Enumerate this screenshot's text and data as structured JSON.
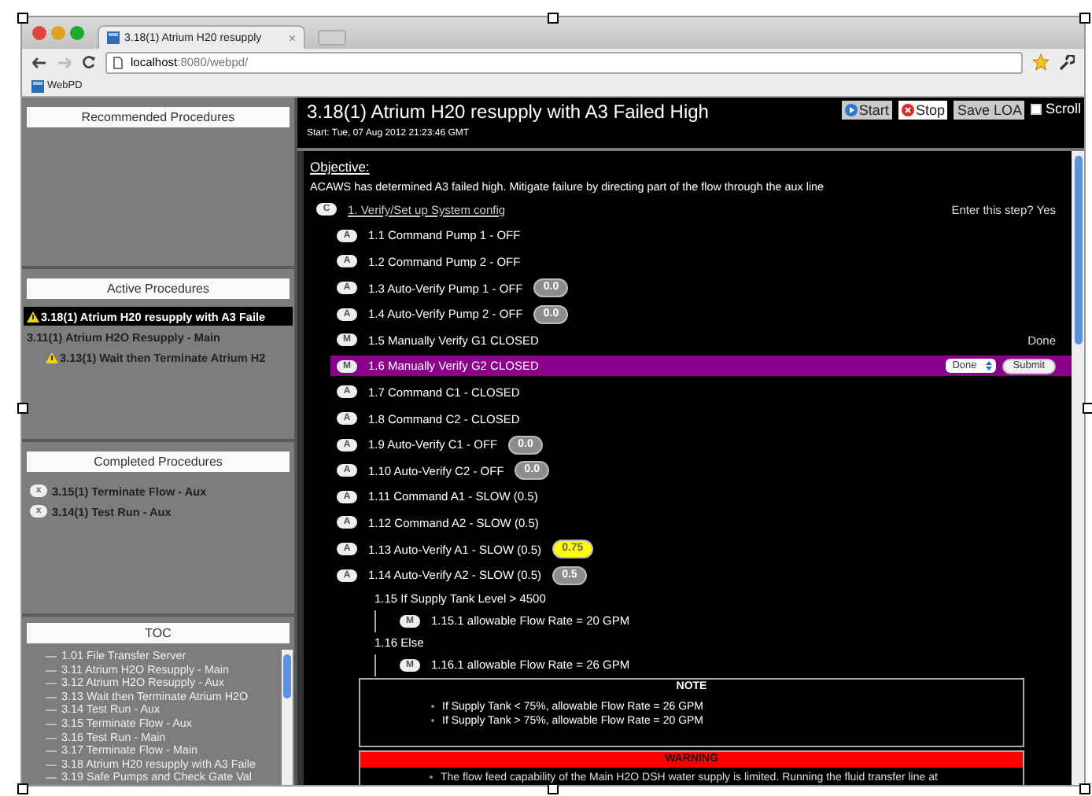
{
  "browser": {
    "tab_title": "3.18(1) Atrium H20 resupply",
    "tab_close": "×",
    "url_host": "localhost",
    "url_path": ":8080/webpd/",
    "bookmark": "WebPD"
  },
  "sidebar": {
    "recommended": {
      "title": "Recommended Procedures"
    },
    "active": {
      "title": "Active Procedures",
      "items": [
        {
          "label": "3.18(1) Atrium H20 resupply with A3 Faile",
          "warning": true,
          "selected": true
        },
        {
          "label": "3.11(1) Atrium H2O Resupply - Main",
          "warning": false,
          "selected": false,
          "children": [
            {
              "label": "3.13(1) Wait then Terminate Atrium H2",
              "warning": true,
              "selected": false
            }
          ]
        }
      ]
    },
    "completed": {
      "title": "Completed Procedures",
      "items": [
        {
          "badge": "x",
          "label": "3.15(1) Terminate Flow - Aux"
        },
        {
          "badge": "x",
          "label": "3.14(1) Test Run - Aux"
        }
      ]
    },
    "toc": {
      "title": "TOC",
      "items": [
        "1.01 File Transfer Server",
        "3.11 Atrium H2O Resupply - Main",
        "3.12 Atrium H2O Resupply - Aux",
        "3.13 Wait then Terminate Atrium H2O",
        "3.14 Test Run - Aux",
        "3.15 Terminate Flow - Aux",
        "3.16 Test Run - Main",
        "3.17 Terminate Flow - Main",
        "3.18 Atrium H20 resupply with A3 Faile",
        "3.19 Safe Pumps and Check Gate Val"
      ]
    }
  },
  "procedure": {
    "title": "3.18(1) Atrium H20 resupply with A3 Failed High",
    "start": "Start: Tue, 07 Aug 2012 21:23:46 GMT",
    "buttons": [
      {
        "kind": "start",
        "label": "Start"
      },
      {
        "kind": "stop",
        "label": "Stop"
      },
      {
        "kind": "plain",
        "label": "Save LOA"
      }
    ],
    "scroll": {
      "label": "Scroll",
      "checked": false
    }
  },
  "objective": {
    "title": "Objective:",
    "text": "ACAWS has determined A3 failed high. Mitigate failure by directing part of the flow through the aux line"
  },
  "steps": [
    {
      "kind": "section",
      "badge": "C",
      "label": "1. Verify/Set up System config",
      "status": "Enter this step? Yes"
    },
    {
      "kind": "step",
      "badge": "A",
      "label": "1.1 Command Pump 1 - OFF",
      "selected": false
    },
    {
      "kind": "step",
      "badge": "A",
      "label": "1.2 Command Pump 2 - OFF",
      "selected": false
    },
    {
      "kind": "step",
      "badge": "A",
      "label": "1.3 Auto-Verify Pump 1 - OFF",
      "selected": false,
      "reading": {
        "text": "0.0",
        "color": "#8c8c8c"
      }
    },
    {
      "kind": "step",
      "badge": "A",
      "label": "1.4 Auto-Verify Pump 2 - OFF",
      "selected": false,
      "reading": {
        "text": "0.0",
        "color": "#8c8c8c"
      }
    },
    {
      "kind": "step",
      "badge": "M",
      "label": "1.5 Manually Verify G1 CLOSED",
      "selected": false,
      "status": "Done"
    },
    {
      "kind": "step",
      "badge": "M",
      "label": "1.6 Manually Verify G2 CLOSED",
      "selected": true,
      "choice": "Done",
      "submit": "Submit"
    },
    {
      "kind": "step",
      "badge": "A",
      "label": "1.7 Command C1 - CLOSED",
      "selected": false
    },
    {
      "kind": "step",
      "badge": "A",
      "label": "1.8 Command C2 - CLOSED",
      "selected": false
    },
    {
      "kind": "step",
      "badge": "A",
      "label": "1.9 Auto-Verify C1 - OFF",
      "selected": false,
      "reading": {
        "text": "0.0",
        "color": "#8c8c8c"
      }
    },
    {
      "kind": "step",
      "badge": "A",
      "label": "1.10 Auto-Verify C2 - OFF",
      "selected": false,
      "reading": {
        "text": "0.0",
        "color": "#8c8c8c"
      }
    },
    {
      "kind": "step",
      "badge": "A",
      "label": "1.11 Command A1 - SLOW (0.5)",
      "selected": false
    },
    {
      "kind": "step",
      "badge": "A",
      "label": "1.12 Command A2 - SLOW (0.5)",
      "selected": false
    },
    {
      "kind": "step",
      "badge": "A",
      "label": "1.13 Auto-Verify A1 - SLOW (0.5)",
      "selected": false,
      "reading": {
        "text": "0.75",
        "color": "#ffff00"
      }
    },
    {
      "kind": "step",
      "badge": "A",
      "label": "1.14 Auto-Verify A2 - SLOW (0.5)",
      "selected": false,
      "reading": {
        "text": "0.5",
        "color": "#8c8c8c"
      }
    },
    {
      "kind": "condition",
      "label": "1.15 If Supply Tank Level > 4500",
      "children": [
        {
          "badge": "M",
          "label": "1.15.1 allowable Flow Rate = 20 GPM"
        }
      ]
    },
    {
      "kind": "condition",
      "label": "1.16 Else",
      "children": [
        {
          "badge": "M",
          "label": "1.16.1 allowable Flow Rate = 26 GPM"
        }
      ]
    }
  ],
  "note": {
    "title": "NOTE",
    "bullets": [
      "If Supply Tank < 75%, allowable Flow Rate = 26 GPM",
      "If Supply Tank > 75%, allowable Flow Rate = 20 GPM"
    ]
  },
  "warning": {
    "title": "WARNING",
    "text": "The flow feed capability of the Main H2O DSH water supply is limited. Running the fluid transfer line at"
  }
}
